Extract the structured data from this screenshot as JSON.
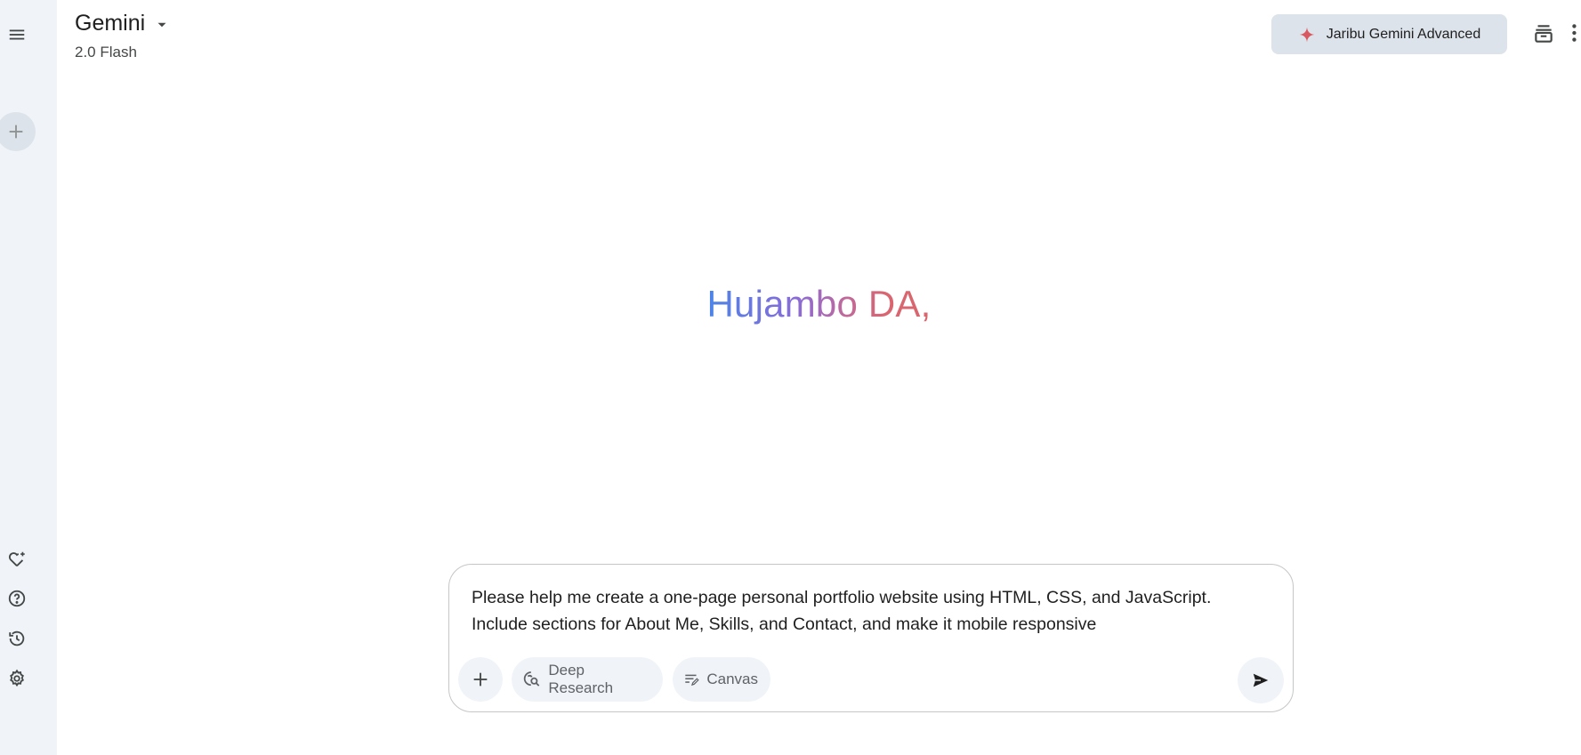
{
  "header": {
    "brand": "Gemini",
    "model": "2.0 Flash",
    "upgrade_label": "Jaribu Gemini Advanced"
  },
  "greeting": "Hujambo DA,",
  "composer": {
    "prompt_text": "Please help me create a one-page personal portfolio website using HTML, CSS, and JavaScript. Include sections for About Me, Skills, and Contact, and make it mobile responsive",
    "chips": {
      "deep_research": "Deep Research",
      "canvas": "Canvas"
    }
  },
  "icons": {
    "menu": "menu-icon",
    "new_chat": "plus-icon",
    "gem_manager": "gem-heart-icon",
    "help": "help-icon",
    "activity": "history-icon",
    "settings": "gear-icon",
    "archive": "archive-icon",
    "more": "more-vert-icon",
    "send": "send-icon",
    "spark": "spark-icon"
  },
  "colors": {
    "rail_bg": "#f0f4f9",
    "spark": "#d9575e",
    "greeting_start": "#4b84e8",
    "greeting_end": "#d9666d"
  }
}
